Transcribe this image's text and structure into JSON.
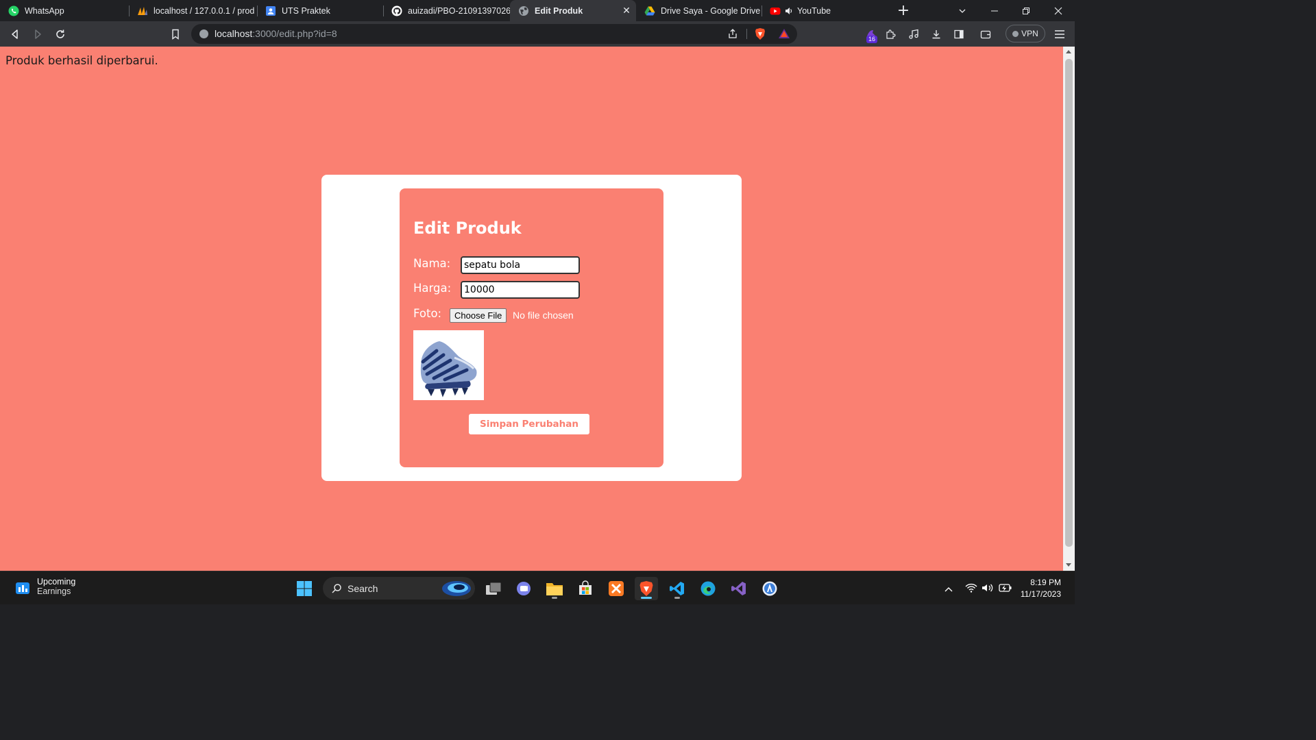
{
  "browser": {
    "tabs": [
      {
        "title": "WhatsApp",
        "icon": "whatsapp-icon",
        "active": false
      },
      {
        "title": "localhost / 127.0.0.1 / prodi",
        "icon": "phpmyadmin-icon",
        "active": false
      },
      {
        "title": "UTS Praktek",
        "icon": "classroom-icon",
        "active": false
      },
      {
        "title": "auizadi/PBO-21091397026",
        "icon": "github-icon",
        "active": false
      },
      {
        "title": "Edit Produk",
        "icon": "globe-icon",
        "active": true
      },
      {
        "title": "Drive Saya - Google Drive",
        "icon": "google-drive-icon",
        "active": false
      },
      {
        "title": "YouTube",
        "icon": "youtube-icon",
        "active": false
      }
    ],
    "new_tab_label": "+",
    "url_host": "localhost",
    "url_rest": ":3000/edit.php?id=8",
    "extensions_badge": "16",
    "vpn_label": "VPN"
  },
  "page": {
    "notice": "Produk berhasil diperbarui.",
    "form": {
      "title": "Edit Produk",
      "nama_label": "Nama:",
      "nama_value": "sepatu bola",
      "harga_label": "Harga:",
      "harga_value": "10000",
      "foto_label": "Foto:",
      "file_button": "Choose File",
      "file_status": "No file chosen",
      "submit_label": "Simpan Perubahan"
    }
  },
  "taskbar": {
    "weather_title": "Upcoming",
    "weather_sub": "Earnings",
    "search_label": "Search",
    "clock_time": "8:19 PM",
    "clock_date": "11/17/2023"
  },
  "colors": {
    "page_bg": "#fa8072",
    "card_bg": "#ffffff",
    "accent": "#fa8072"
  }
}
